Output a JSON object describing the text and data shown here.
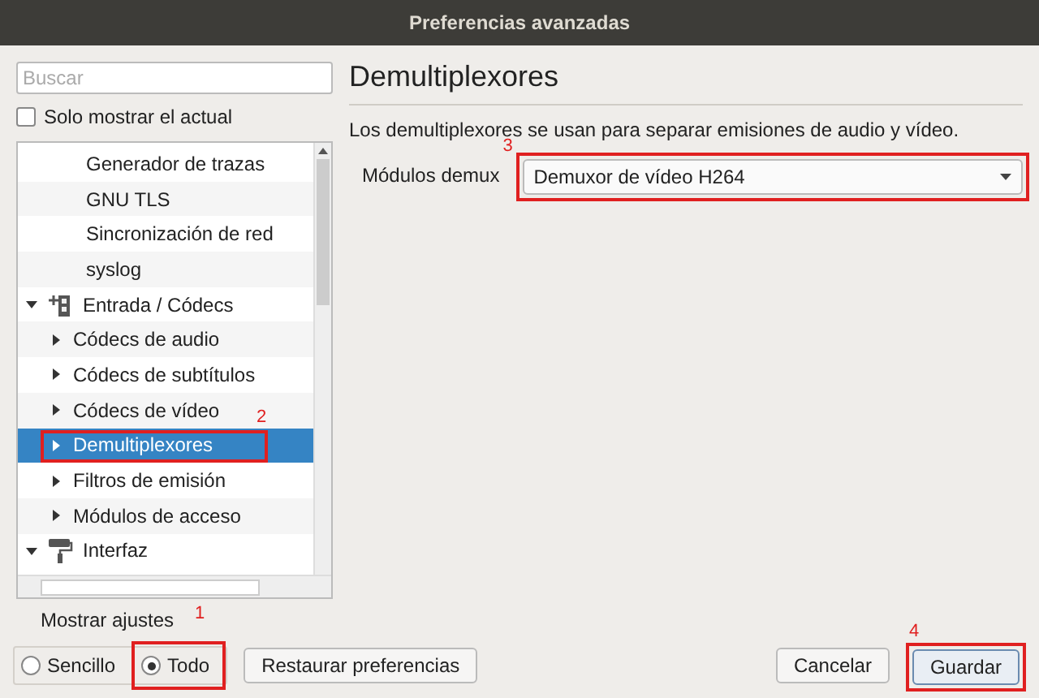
{
  "window": {
    "title": "Preferencias avanzadas"
  },
  "sidebar": {
    "search": {
      "placeholder": "Buscar"
    },
    "only_current": {
      "label": "Solo mostrar el actual",
      "checked": false
    },
    "tree": {
      "continued_items": [
        {
          "label": "Generador de trazas",
          "selected": false
        },
        {
          "label": "GNU TLS",
          "selected": false
        },
        {
          "label": "Sincronización de red",
          "selected": false
        },
        {
          "label": "syslog",
          "selected": false
        }
      ],
      "categories": [
        {
          "label": "Entrada / Códecs",
          "kind": "codec",
          "expanded": true,
          "children": [
            {
              "label": "Códecs de audio",
              "expanded": false,
              "selected": false
            },
            {
              "label": "Códecs de subtítulos",
              "expanded": false,
              "selected": false
            },
            {
              "label": "Códecs de vídeo",
              "expanded": false,
              "selected": false
            },
            {
              "label": "Demultiplexores",
              "expanded": false,
              "selected": true,
              "annotation": "2"
            },
            {
              "label": "Filtros de emisión",
              "expanded": false,
              "selected": false
            },
            {
              "label": "Módulos de acceso",
              "expanded": false,
              "selected": false
            }
          ]
        },
        {
          "label": "Interfaz",
          "kind": "roller",
          "expanded": true
        }
      ]
    }
  },
  "panel": {
    "heading": "Demultiplexores",
    "description": "Los demultiplexores se usan para separar emisiones de audio y vídeo.",
    "setting": {
      "label": "Módulos demux",
      "value": "Demuxor de vídeo H264",
      "annotation": "3"
    }
  },
  "footer": {
    "show_settings": {
      "label": "Mostrar ajustes",
      "annotation": "1",
      "options": [
        {
          "label": "Sencillo",
          "selected": false
        },
        {
          "label": "Todo",
          "selected": true
        }
      ]
    },
    "buttons": [
      {
        "label": "Restaurar preferencias",
        "default": false
      },
      {
        "label": "Cancelar",
        "default": false
      },
      {
        "label": "Guardar",
        "default": true,
        "annotation": "4"
      }
    ]
  }
}
